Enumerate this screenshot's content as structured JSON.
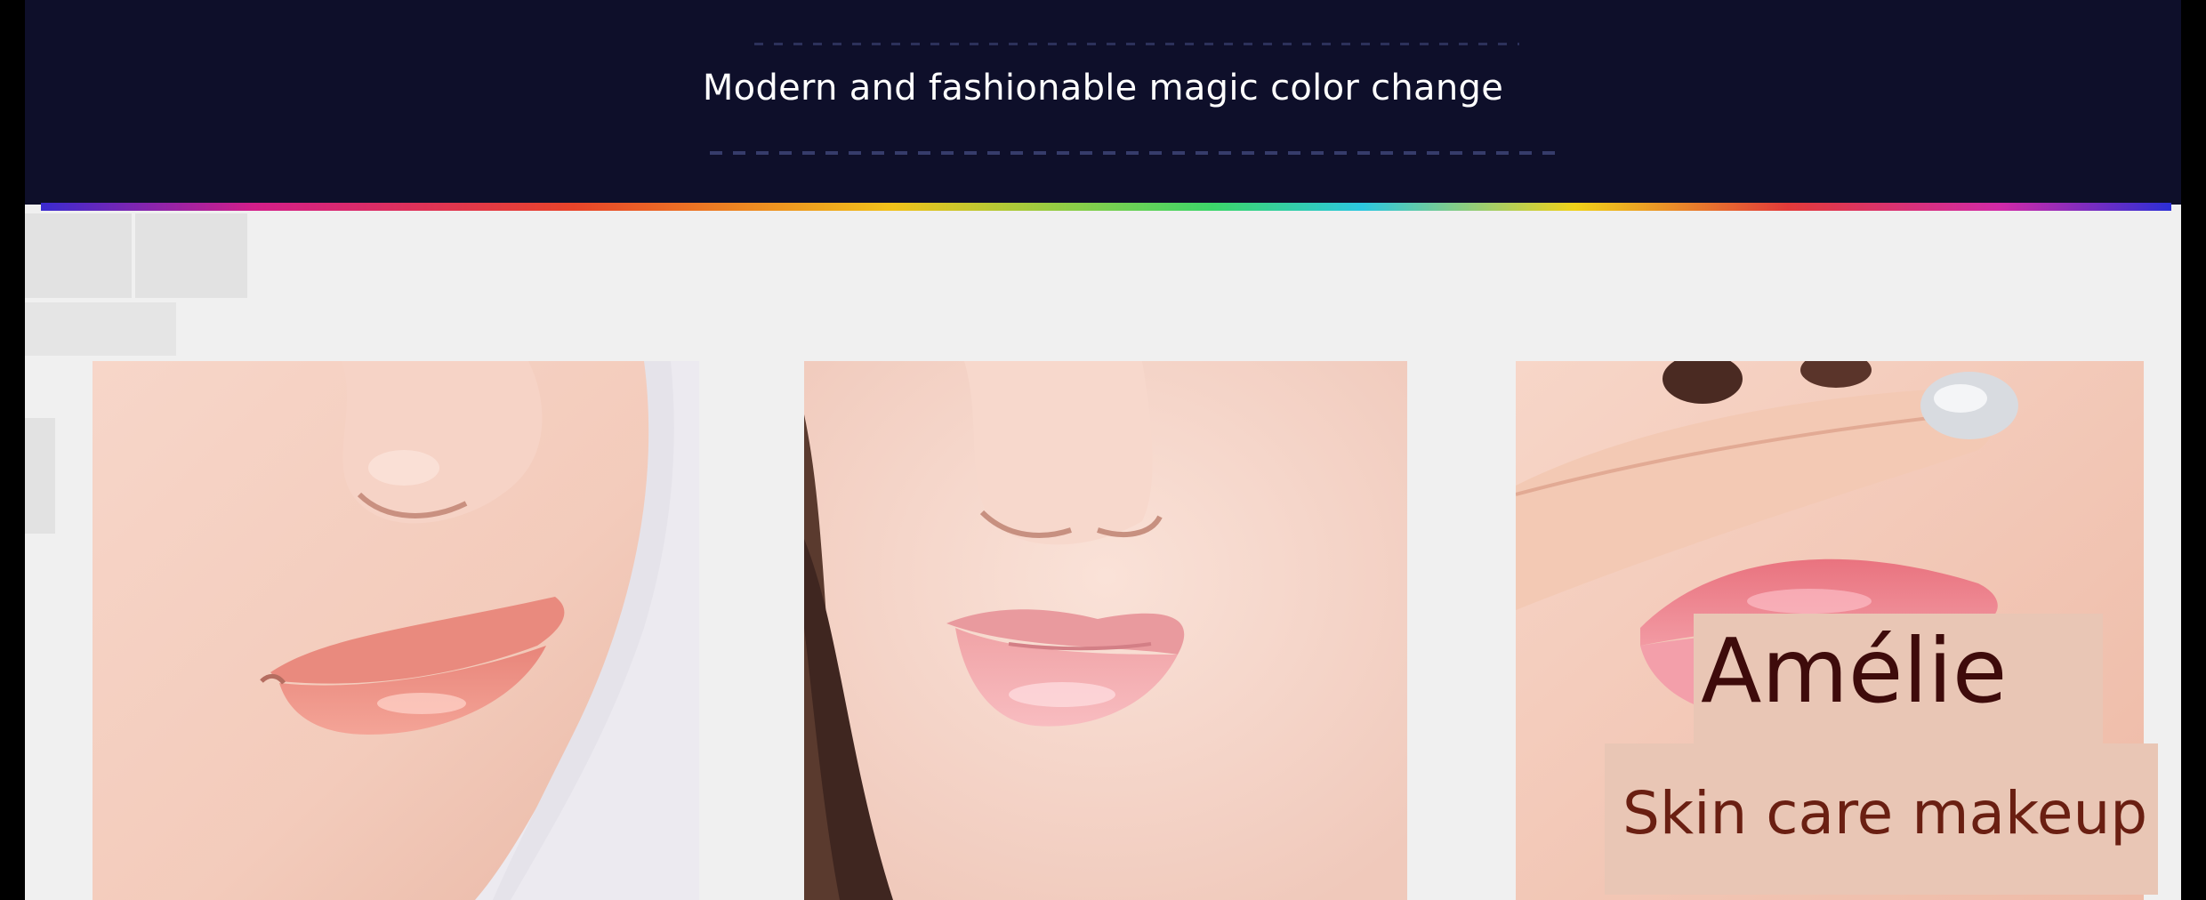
{
  "banner": {
    "title": "Modern and fashionable magic color change"
  },
  "overlay": {
    "brand": "Amélie",
    "tagline": "Skin care makeup"
  },
  "colors": {
    "header_bg": "#0e0f2a",
    "panel_bg": "#f0f0f0",
    "label_bg": "#e9c6b5",
    "brand_text": "#3e0b0b",
    "tagline_text": "#6a1f12"
  },
  "photos": [
    {
      "subject": "lower-face-side-view-lips"
    },
    {
      "subject": "lower-face-front-view-lips"
    },
    {
      "subject": "finger-on-lips-closeup"
    }
  ]
}
